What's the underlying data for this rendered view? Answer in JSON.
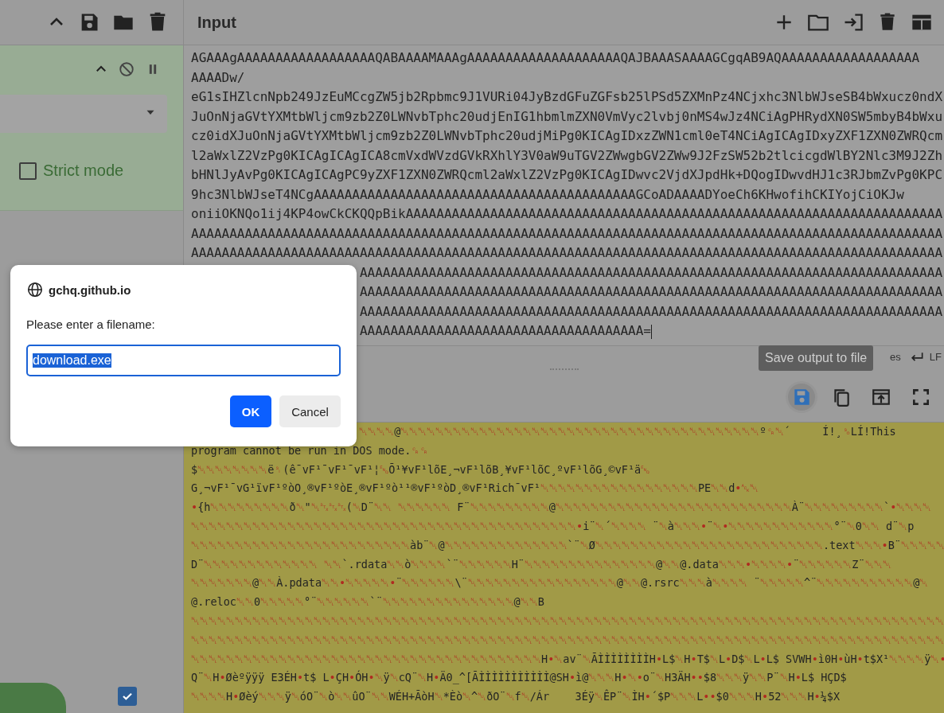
{
  "recipe": {
    "strict_mode": {
      "label": "Strict mode",
      "checked": false
    },
    "auto_bake": {
      "checked": true
    }
  },
  "input": {
    "title": "Input",
    "lines": [
      {
        "kind": "full",
        "text": "AGAAAgAAAAAAAAAAAAAAAAAAQABAAAAMAAAgAAAAAAAAAAAAAAAAAAAAQAJBAAASAAAAGCgqAB9AQAAAAAAAAAAAAAAAAAA"
      },
      {
        "kind": "full",
        "text": "AAAADw/"
      },
      {
        "kind": "full",
        "text": "eG1sIHZlcnNpb249JzEuMCcgZW5jb2Rpbmc9J1VURi04JyBzdGFuZGFsb25lPSd5ZXMnPz4NCjxhc3NlbWJseSB4bWxucz0ndX"
      },
      {
        "kind": "full",
        "text": "JuOnNjaGVtYXMtbWljcm9zb2Z0LWNvbTphc20udjEnIG1hbmlmZXN0VmVyc2lvbj0nMS4wJz4NCiAgPHRydXN0SW5mbyB4bWxu"
      },
      {
        "kind": "full",
        "text": "cz0idXJuOnNjaGVtYXMtbWljcm9zb2Z0LWNvbTphc20udjMiPg0KICAgIDxzZWN1cml0eT4NCiAgICAgIDxyZXF1ZXN0ZWRQcm"
      },
      {
        "kind": "full",
        "text": "l2aWxlZ2VzPg0KICAgICAgICA8cmVxdWVzdGVkRXhlY3V0aW9uTGV2ZWwgbGV2ZWw9J2FzSW52b2tlcicgdWlBY2Nlc3M9J2Zh"
      },
      {
        "kind": "full",
        "text": "bHNlJyAvPg0KICAgICAgPC9yZXF1ZXN0ZWRQcml2aWxlZ2VzPg0KICAgIDwvc2VjdXJpdHk+DQogIDwvdHJ1c3RJbmZvPg0KPC"
      },
      {
        "kind": "full",
        "text": "9hc3NlbWJseT4NCgAAAAAAAAAAAAAAAAAAAAAAAAAAAAAAAAAAAAAAAAAAGCoADAAAADYoeCh6KHwofihCKIYojCiOKJw"
      },
      {
        "kind": "full",
        "text": "oniiOKNQo1ij4KP4owCkCKQQpBikAAAAAAAAAAAAAAAAAAAAAAAAAAAAAAAAAAAAAAAAAAAAAAAAAAAAAAAAAAAAAAAAAAAAAA"
      },
      {
        "kind": "full",
        "text": "AAAAAAAAAAAAAAAAAAAAAAAAAAAAAAAAAAAAAAAAAAAAAAAAAAAAAAAAAAAAAAAAAAAAAAAAAAAAAAAAAAAAAAAAAAAAAAAAAA"
      },
      {
        "kind": "full",
        "text": "AAAAAAAAAAAAAAAAAAAAAAAAAAAAAAAAAAAAAAAAAAAAAAAAAAAAAAAAAAAAAAAAAAAAAAAAAAAAAAAAAAAAAAAAAAAAAAAAAA"
      },
      {
        "kind": "covered",
        "text": "AAAAAAAAAAAAAAAAAAAAAAAAAAAAAAAAAAAAAAAAAAAAAAAAAAAAAAAAAAAAAAAAAAAAAAAAAAAA"
      },
      {
        "kind": "covered",
        "text": "AAAAAAAAAAAAAAAAAAAAAAAAAAAAAAAAAAAAAAAAAAAAAAAAAAAAAAAAAAAAAAAAAAAAAAAAAAAA"
      },
      {
        "kind": "covered",
        "text": "AAAAAAAAAAAAAAAAAAAAAAAAAAAAAAAAAAAAAAAAAAAAAAAAAAAAAAAAAAAAAAAAAAAAAAAAAAAA"
      },
      {
        "kind": "covered",
        "text": "AAAAAAAAAAAAAAAAAAAAAAAAAAAAAAAAAAAAA="
      }
    ],
    "status": [
      {
        "text": "es"
      },
      {
        "text": "LF"
      }
    ]
  },
  "output": {
    "toolbar": [
      {
        "kind": "save",
        "highlighted": true
      },
      {
        "kind": "copy",
        "highlighted": false
      },
      {
        "kind": "replace",
        "highlighted": false
      },
      {
        "kind": "maximise",
        "highlighted": false
      }
    ],
    "lines": [
      {
        "kind": "covered",
        "text": "␀␀␀␀@␀␀␀␀␀␀␀␀␀␀␀␀␀␀␀␀␀␀␀␀␀␀␀␀␀␀␀␀␀␀␀␀␀␀␀␀␀␀␀␀␀º␍␀´     Í!¸␎LÍ!This"
      },
      {
        "kind": "full",
        "text": "program cannot be run in DOS mode.␍␍"
      },
      {
        "kind": "full",
        "text": "$␀␀␀␀␀␀␀␀ë␏(ê¯vF¹¯vF¹¯vF¹¦␅Õ¹¥vF¹lõE¸¬vF¹lõB¸¥vF¹lõC¸ºvF¹lõG¸©vF¹ä␅"
      },
      {
        "kind": "full",
        "text": "G¸¬vF¹¯vG¹ïvF¹ºòO¸®vF¹ºòE¸®vF¹ºò¹¹®vF¹ºòD¸®vF¹Rich¯vF¹␀␀␀␀␀␀␀␀␀␀␀␀␀␀␀␀␀␀PE␀␀d•␆␀"
      },
      {
        "kind": "full",
        "text": "•{h␀␀␀␀␀␀␀␀␀ð␀\"␀␂␂␂(␀D¨␀␀ ␀␀␀␀␀␀ F¨␀␀␀␀␀␀␀␀␀@␀␀␀␀␀␀␀␀␀␀␀␀␀␀␀␀␀␀␀␀␀␀␀␀␀␀␀À¨␀␀␀␀␀␀␀␀␀`•␀␀␀␀"
      },
      {
        "kind": "full",
        "text": "␀␀␀␀␀␀␀␀␀␀␀␀␀␀␀␀␀␀␀␀␀␀␀␀␀␀␀␀␀␀␀␀␀␀␀␀␀␀␀␀␀␀␀␀•i¨␀´␀␀␀␀ ¨␀à␀␀␀•¨␀•␀␀␀␀␀␀␀␀␀␀␀␀°¨␀0␀␀ d¨␀p"
      },
      {
        "kind": "full",
        "text": "␀␀␀␀␀␀␀␀␀␀␀␀␀␀␀␀␀␀␀␀␀␀␀␀␀àb¨␀@␀␀␀␀␀␀␀␀␀␀␀␀␀␀`¨␀Ø␀␀␀␀␀␀␀␀␀␀␀␀␀␀␀␀␀␀␀␀␀␀␀␀␀␀.text␀␀␀•B¨␀␀␀␀␀"
      },
      {
        "kind": "full",
        "text": "D¨␀␀␀␀␀␀␀␀␀␀␀␀␀ ␀␀`.rdata␀␀ò␀␀␀␀`¨␀␀␀␀␀␀H¨␀␀␀␀␀␀␀␀␀␀␀␀␀␀␀@␀␀@.data␀␀␀•␀␀␀␀•¨␀␀␀␀␀␀Z¨␀␀␀"
      },
      {
        "kind": "full",
        "text": "␀␀␀␀␀␀␀@␀␀À.pdata␀␀•␀␀␀␀␀•¨␀␀␀␀␀␀\\¨␀␀␀␀␀␀␀␀␀␀␀␀␀␀␀␀␀@␀␀@.rsrc␀␀␀à␀␀␀␀ ¨␀␀␀␀␀^¨␀␀␀␀␀␀␀␀␀␀␀@␀"
      },
      {
        "kind": "full",
        "text": "@.reloc␀␀0␀␀␀␀␀°¨␀␀␀␀␀␀`¨␀␀␀␀␀␀␀␀␀␀␀␀␀␀␀@␀␀B"
      },
      {
        "kind": "full",
        "text": "␀␀␀␀␀␀␀␀␀␀␀␀␀␀␀␀␀␀␀␀␀␀␀␀␀␀␀␀␀␀␀␀␀␀␀␀␀␀␀␀␀␀␀␀␀␀␀␀␀␀␀␀␀␀␀␀␀␀␀␀␀␀␀␀␀␀␀␀␀␀␀␀␀␀␀␀␀␀␀␀␀␀␀␀␀␀␀␀␀␀␀␀␀␀␀"
      },
      {
        "kind": "full",
        "text": "␀␀␀␀␀␀␀␀␀␀␀␀␀␀␀␀␀␀␀␀␀␀␀␀␀␀␀␀␀␀␀␀␀␀␀␀␀␀␀␀␀␀␀␀␀␀␀␀␀␀␀␀␀␀␀␀␀␀␀␀␀␀␀␀␀␀␀␀␀␀␀␀␀␀␀␀␀␀␀␀␀␀␀␀␀␀␀␀␀␀␀␀␀␀␀"
      },
      {
        "kind": "full",
        "text": "␀␀␀␀␀␀␀␀␀␀␀␀␀␀␀␀␀␀␀␀␀␀␀␀␀␀␀␀␀␀␀␀␀␀␀␀␀␀␀␀H•␀av¨␀ÃÌÌÌÌÌÌÌÌH•L$␀H•T$␀L•D$␀L•L$ SVWH•ì0H•ùH•t$X¹␀␀␀␀ÿ␀•"
      },
      {
        "kind": "full",
        "text": "Q¨␀H•Øèºÿÿÿ E3ÉH•t$ L•ÇH•ÓH•␀ÿ␀cQ¨␀H•Ä0_^[ÃÌÌÌÌÌÌÌÌÌÌÌ@SH•ì@␀␀␀H•␀•o¨␀H3ÄH••$8␀␀␀ÿ␀␀P¨␀H•L$ HÇD$"
      },
      {
        "kind": "full",
        "text": "␀␀␀␀H•Øèý␀␀␀ÿ␀óO¨␀ò␀␀ûO¨␀␀WÉH+ÃòH␀*Èò␀^␀ðO¨␀f␀/Ár    3Éÿ␀ÊP¨␀ÌH•´$P␀␀␀L••$0␀␀␀H•52␀␀␀H•¼$X"
      }
    ]
  },
  "tooltip": {
    "text": "Save output to file"
  },
  "dialog": {
    "origin": "gchq.github.io",
    "message": "Please enter a filename:",
    "value": "download.exe",
    "value_selected": true,
    "buttons": [
      {
        "label": "OK",
        "kind": "primary"
      },
      {
        "label": "Cancel",
        "kind": "secondary"
      }
    ]
  }
}
